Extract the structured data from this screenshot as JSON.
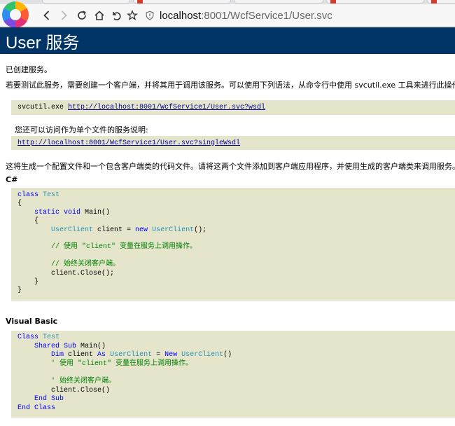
{
  "browser": {
    "nav": {
      "back_icon": "chevron-left-icon",
      "forward_icon": "chevron-right-icon",
      "reload_icon": "reload-icon",
      "home_icon": "home-icon",
      "undo_icon": "undo-icon",
      "bookmark_icon": "star-icon"
    },
    "address": {
      "security_icon": "shield-icon",
      "url_host": "localhost",
      "url_rest": ":8001/WcfService1/User.svc"
    }
  },
  "page": {
    "title": "User 服务",
    "created_text": "已创建服务。",
    "intro_text": "若要测试此服务，需要创建一个客户端，并将其用于调用该服务。可以使用下列语法，从命令行中使用 svcutil.exe 工具来进行此操作:",
    "svcutil_cmd": "svcutil.exe ",
    "wsdl_link": "http://localhost:8001/WcfService1/User.svc?wsdl",
    "single_file_text": "您还可以访问作为单个文件的服务说明:",
    "single_wsdl_link": "http://localhost:8001/WcfService1/User.svc?singleWsdl",
    "generate_text": "这将生成一个配置文件和一个包含客户端类的代码文件。请将这两个文件添加到客户端应用程序，并使用生成的客户端类来调用服务。例如:",
    "csharp_label": "C#",
    "vb_label": "Visual Basic"
  },
  "csharp_code": {
    "l1_kw": "class",
    "l1_ty": "Test",
    "l2": "{",
    "l3_kw": "static void",
    "l3_rest": " Main()",
    "l4": "{",
    "l5_ty1": "UserClient",
    "l5_mid": " client = ",
    "l5_kw": "new",
    "l5_ty2": "UserClient",
    "l5_end": "();",
    "l6_cm": "// 使用 \"client\" 变量在服务上调用操作。",
    "l7_cm": "// 始终关闭客户端。",
    "l8": "client.Close();",
    "l9": "}",
    "l10": "}"
  },
  "vb_code": {
    "l1_kw": "Class",
    "l1_ty": "Test",
    "l2_kw": "Shared Sub",
    "l2_rest": " Main()",
    "l3_kw1": "Dim",
    "l3_mid": " client ",
    "l3_kw2": "As",
    "l3_ty1": "UserClient",
    "l3_eq": " = ",
    "l3_kw3": "New",
    "l3_ty2": "UserClient",
    "l3_end": "()",
    "l4_cm": "' 使用 \"client\" 变量在服务上调用操作。",
    "l5_cm": "' 始终关闭客户端。",
    "l6": "client.Close()",
    "l7_kw": "End Sub",
    "l8_kw": "End Class"
  },
  "colors": {
    "header_bg": "#003366",
    "code_bg": "#e5e5cc",
    "link": "#000099",
    "keyword": "#0000ff",
    "type": "#2b91af",
    "comment": "#008000"
  }
}
